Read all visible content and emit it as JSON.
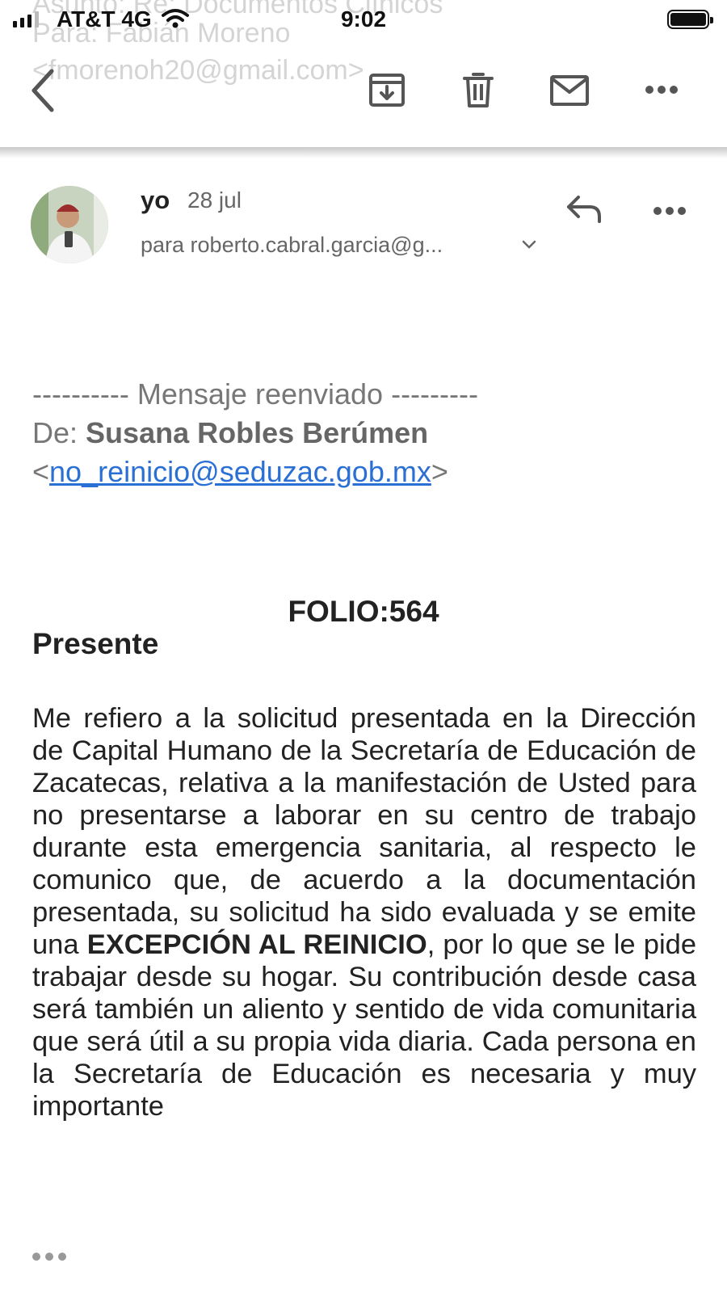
{
  "background_ghost": {
    "line1": "Asunto: Re: Documentos Clínicos",
    "line2": "Para: Fabián Moreno",
    "line3": "<fmorenoh20@gmail.com>"
  },
  "status_bar": {
    "carrier": "AT&T 4G",
    "time": "9:02"
  },
  "toolbar": {
    "icons": [
      "back-icon",
      "archive-icon",
      "trash-icon",
      "mail-icon",
      "more-icon"
    ]
  },
  "message": {
    "sender": "yo",
    "date": "28 jul",
    "recipient": "para roberto.cabral.garcia@g...",
    "forward_header": "---------- Mensaje reenviado ---------",
    "from_label": "De:",
    "from_name": "Susana Robles Berúmen",
    "from_email": "no_reinicio@seduzac.gob.mx",
    "lt": "<",
    "gt": ">",
    "folio": "FOLIO:564",
    "greeting": "Presente",
    "body_part1": "Me refiero a la solicitud presentada en la Dirección de Capital Humano de la Secretaría de Educación de Zacatecas, relativa a la manifestación de Usted para no presentarse a laborar en su centro de trabajo durante esta emergencia sanitaria, al respecto le comunico que, de acuerdo a la documentación presentada, su solicitud ha sido evaluada y se emite una ",
    "body_bold": "EXCEPCIÓN AL REINICIO",
    "body_part2": ", por lo que se le pide trabajar desde su hogar. Su contribución desde casa será también un aliento y sentido de vida comunitaria que será útil a su propia vida diaria. Cada persona en la Secretaría de Educación es necesaria y muy importante"
  }
}
